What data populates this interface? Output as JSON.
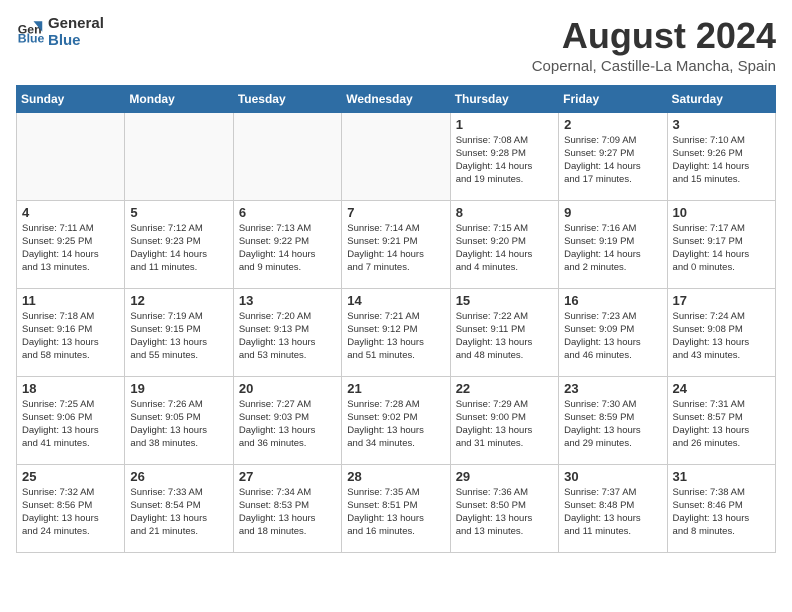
{
  "header": {
    "logo_general": "General",
    "logo_blue": "Blue",
    "month": "August 2024",
    "location": "Copernal, Castille-La Mancha, Spain"
  },
  "weekdays": [
    "Sunday",
    "Monday",
    "Tuesday",
    "Wednesday",
    "Thursday",
    "Friday",
    "Saturday"
  ],
  "weeks": [
    [
      {
        "day": "",
        "info": ""
      },
      {
        "day": "",
        "info": ""
      },
      {
        "day": "",
        "info": ""
      },
      {
        "day": "",
        "info": ""
      },
      {
        "day": "1",
        "info": "Sunrise: 7:08 AM\nSunset: 9:28 PM\nDaylight: 14 hours\nand 19 minutes."
      },
      {
        "day": "2",
        "info": "Sunrise: 7:09 AM\nSunset: 9:27 PM\nDaylight: 14 hours\nand 17 minutes."
      },
      {
        "day": "3",
        "info": "Sunrise: 7:10 AM\nSunset: 9:26 PM\nDaylight: 14 hours\nand 15 minutes."
      }
    ],
    [
      {
        "day": "4",
        "info": "Sunrise: 7:11 AM\nSunset: 9:25 PM\nDaylight: 14 hours\nand 13 minutes."
      },
      {
        "day": "5",
        "info": "Sunrise: 7:12 AM\nSunset: 9:23 PM\nDaylight: 14 hours\nand 11 minutes."
      },
      {
        "day": "6",
        "info": "Sunrise: 7:13 AM\nSunset: 9:22 PM\nDaylight: 14 hours\nand 9 minutes."
      },
      {
        "day": "7",
        "info": "Sunrise: 7:14 AM\nSunset: 9:21 PM\nDaylight: 14 hours\nand 7 minutes."
      },
      {
        "day": "8",
        "info": "Sunrise: 7:15 AM\nSunset: 9:20 PM\nDaylight: 14 hours\nand 4 minutes."
      },
      {
        "day": "9",
        "info": "Sunrise: 7:16 AM\nSunset: 9:19 PM\nDaylight: 14 hours\nand 2 minutes."
      },
      {
        "day": "10",
        "info": "Sunrise: 7:17 AM\nSunset: 9:17 PM\nDaylight: 14 hours\nand 0 minutes."
      }
    ],
    [
      {
        "day": "11",
        "info": "Sunrise: 7:18 AM\nSunset: 9:16 PM\nDaylight: 13 hours\nand 58 minutes."
      },
      {
        "day": "12",
        "info": "Sunrise: 7:19 AM\nSunset: 9:15 PM\nDaylight: 13 hours\nand 55 minutes."
      },
      {
        "day": "13",
        "info": "Sunrise: 7:20 AM\nSunset: 9:13 PM\nDaylight: 13 hours\nand 53 minutes."
      },
      {
        "day": "14",
        "info": "Sunrise: 7:21 AM\nSunset: 9:12 PM\nDaylight: 13 hours\nand 51 minutes."
      },
      {
        "day": "15",
        "info": "Sunrise: 7:22 AM\nSunset: 9:11 PM\nDaylight: 13 hours\nand 48 minutes."
      },
      {
        "day": "16",
        "info": "Sunrise: 7:23 AM\nSunset: 9:09 PM\nDaylight: 13 hours\nand 46 minutes."
      },
      {
        "day": "17",
        "info": "Sunrise: 7:24 AM\nSunset: 9:08 PM\nDaylight: 13 hours\nand 43 minutes."
      }
    ],
    [
      {
        "day": "18",
        "info": "Sunrise: 7:25 AM\nSunset: 9:06 PM\nDaylight: 13 hours\nand 41 minutes."
      },
      {
        "day": "19",
        "info": "Sunrise: 7:26 AM\nSunset: 9:05 PM\nDaylight: 13 hours\nand 38 minutes."
      },
      {
        "day": "20",
        "info": "Sunrise: 7:27 AM\nSunset: 9:03 PM\nDaylight: 13 hours\nand 36 minutes."
      },
      {
        "day": "21",
        "info": "Sunrise: 7:28 AM\nSunset: 9:02 PM\nDaylight: 13 hours\nand 34 minutes."
      },
      {
        "day": "22",
        "info": "Sunrise: 7:29 AM\nSunset: 9:00 PM\nDaylight: 13 hours\nand 31 minutes."
      },
      {
        "day": "23",
        "info": "Sunrise: 7:30 AM\nSunset: 8:59 PM\nDaylight: 13 hours\nand 29 minutes."
      },
      {
        "day": "24",
        "info": "Sunrise: 7:31 AM\nSunset: 8:57 PM\nDaylight: 13 hours\nand 26 minutes."
      }
    ],
    [
      {
        "day": "25",
        "info": "Sunrise: 7:32 AM\nSunset: 8:56 PM\nDaylight: 13 hours\nand 24 minutes."
      },
      {
        "day": "26",
        "info": "Sunrise: 7:33 AM\nSunset: 8:54 PM\nDaylight: 13 hours\nand 21 minutes."
      },
      {
        "day": "27",
        "info": "Sunrise: 7:34 AM\nSunset: 8:53 PM\nDaylight: 13 hours\nand 18 minutes."
      },
      {
        "day": "28",
        "info": "Sunrise: 7:35 AM\nSunset: 8:51 PM\nDaylight: 13 hours\nand 16 minutes."
      },
      {
        "day": "29",
        "info": "Sunrise: 7:36 AM\nSunset: 8:50 PM\nDaylight: 13 hours\nand 13 minutes."
      },
      {
        "day": "30",
        "info": "Sunrise: 7:37 AM\nSunset: 8:48 PM\nDaylight: 13 hours\nand 11 minutes."
      },
      {
        "day": "31",
        "info": "Sunrise: 7:38 AM\nSunset: 8:46 PM\nDaylight: 13 hours\nand 8 minutes."
      }
    ]
  ]
}
